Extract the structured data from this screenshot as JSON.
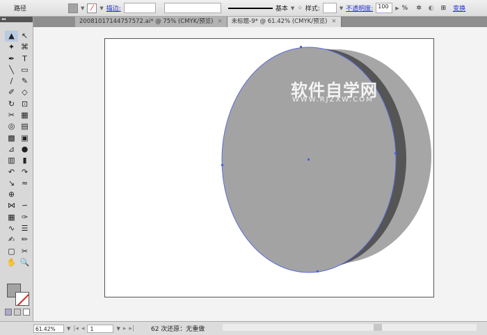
{
  "control_bar": {
    "object_type": "路径",
    "fill_color": "#a3a3a3",
    "stroke_label": "描边:",
    "stroke_weight": "",
    "brush_label": "基本",
    "style_label": "样式:",
    "opacity_label": "不透明度:",
    "opacity_value": "100",
    "percent": "%",
    "transform_label": "变换"
  },
  "tabs": [
    {
      "label": "20081017144757572.ai* @ 75% (CMYK/预览)",
      "active": false
    },
    {
      "label": "未标题-9* @ 61.42% (CMYK/预览)",
      "active": true
    }
  ],
  "tools": [
    "▲",
    "↖",
    "✦",
    "⌘",
    "✒",
    "T",
    "╲",
    "▭",
    "∕",
    "✎",
    "✐",
    "◇",
    "↻",
    "⊡",
    "✂",
    "▦",
    "◎",
    "▤",
    "▩",
    "▣",
    "⊿",
    "●",
    "▥",
    "▮",
    "↶",
    "↷",
    "↘",
    "≈",
    "⊕",
    "",
    "⋈",
    "∽",
    "▦",
    "✑",
    "∿",
    "☰",
    "✍",
    "✏",
    "▢",
    "✂",
    "✋",
    "🔍"
  ],
  "canvas": {
    "watermark_title": "软件自学网",
    "watermark_url": "WWW.RJZXW.COM"
  },
  "status": {
    "zoom": "61.42%",
    "page": "1",
    "message": "62 次还原：无重做"
  }
}
